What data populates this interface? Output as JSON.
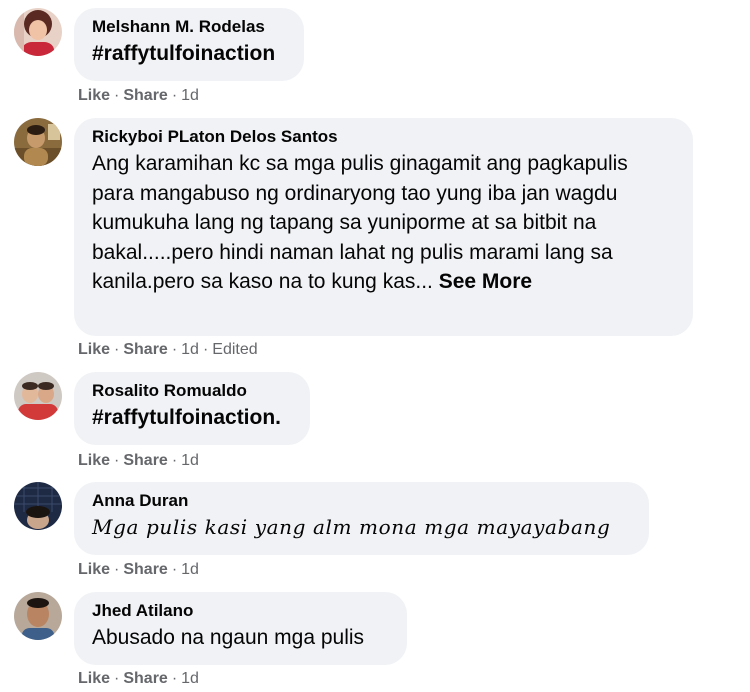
{
  "comments": [
    {
      "author": "Melshann M. Rodelas",
      "text": "#raffytulfoinaction",
      "like": "Like",
      "share": "Share",
      "time": "1d",
      "edited": ""
    },
    {
      "author": "Rickyboi PLaton Delos Santos",
      "text": "Ang karamihan kc sa mga pulis ginagamit ang pagkapulis para mangabuso ng ordinaryong tao yung iba jan wagdu kumukuha lang ng tapang sa yuniporme at sa bitbit na bakal.....pero hindi naman lahat ng pulis marami lang sa kanila.pero sa kaso na to kung kas...",
      "see_more": "See More",
      "like": "Like",
      "share": "Share",
      "time": "1d",
      "edited": "Edited"
    },
    {
      "author": "Rosalito Romualdo",
      "text": "#raffytulfoinaction.",
      "like": "Like",
      "share": "Share",
      "time": "1d",
      "edited": ""
    },
    {
      "author": "Anna Duran",
      "text": "Mga pulis kasi yang alm mona mga mayayabang",
      "like": "Like",
      "share": "Share",
      "time": "1d",
      "edited": ""
    },
    {
      "author": "Jhed Atilano",
      "text": "Abusado na ngaun mga pulis",
      "like": "Like",
      "share": "Share",
      "time": "1d",
      "edited": ""
    }
  ],
  "separator": "·"
}
